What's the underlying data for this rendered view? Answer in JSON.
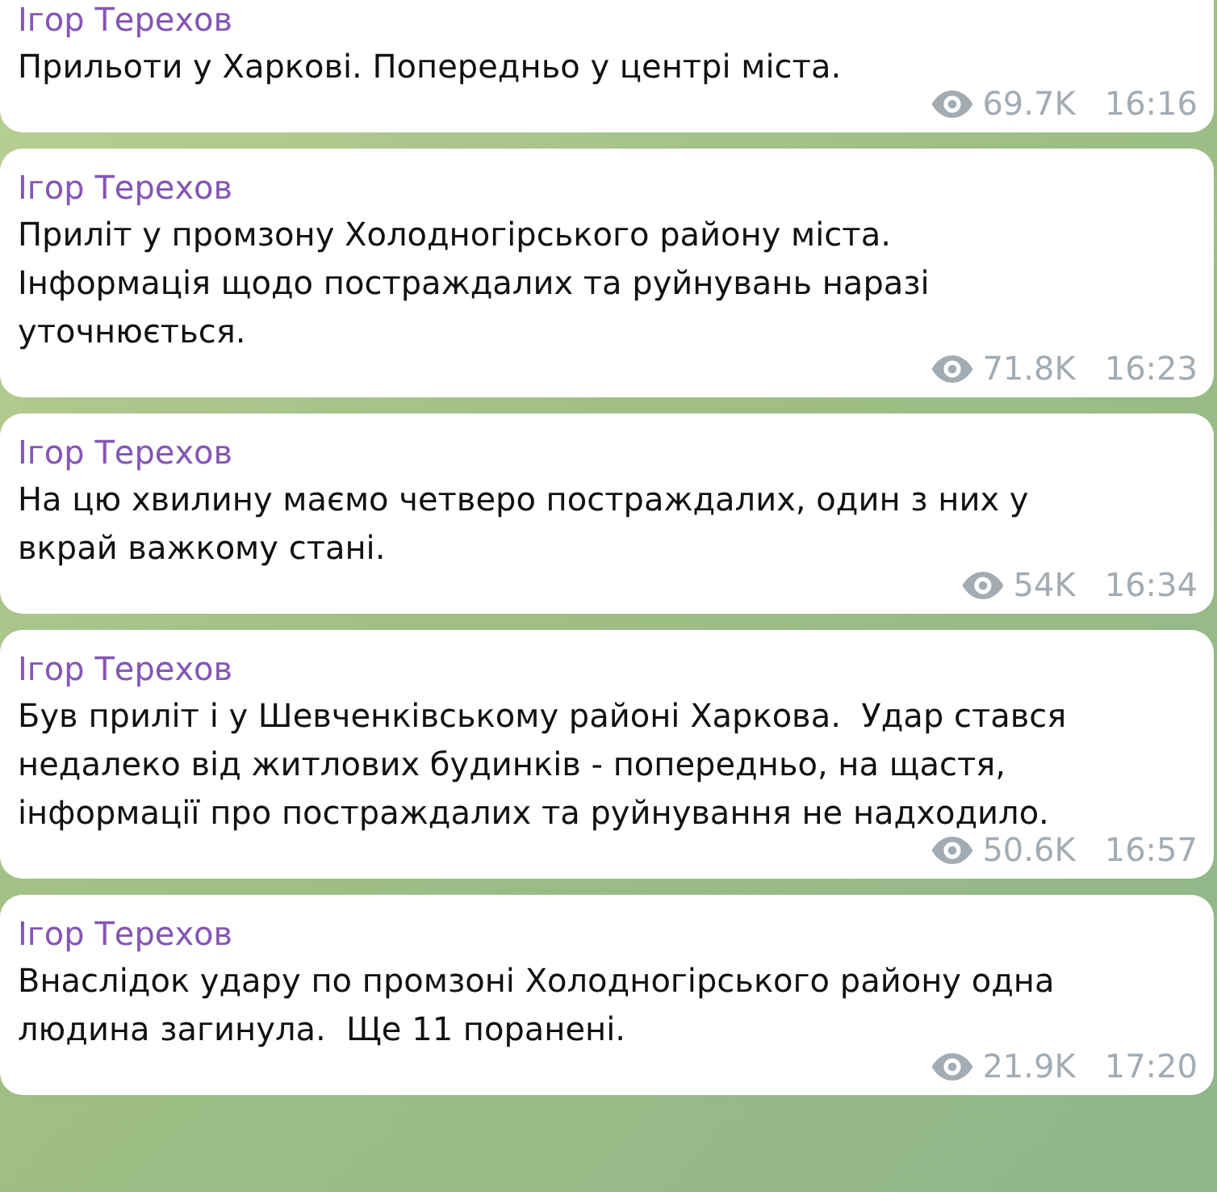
{
  "messages": [
    {
      "author": "Ігор Терехов",
      "text": "Прильоти у Харкові. Попередньо у центрі міста.",
      "views": "69.7K",
      "time": "16:16"
    },
    {
      "author": "Ігор Терехов",
      "text": "Приліт у промзону Холодногірського району міста.\nІнформація щодо постраждалих та руйнувань наразі\nуточнюється.",
      "views": "71.8K",
      "time": "16:23"
    },
    {
      "author": "Ігор Терехов",
      "text": "На цю хвилину маємо четверо постраждалих, один з них у\nвкрай важкому стані.",
      "views": "54K",
      "time": "16:34"
    },
    {
      "author": "Ігор Терехов",
      "text": "Був приліт і у Шевченківському районі Харкова.  Удар стався\nнедалеко від житлових будинків - попередньо, на щастя,\nінформації про постраждалих та руйнування не надходило.",
      "views": "50.6K",
      "time": "16:57"
    },
    {
      "author": "Ігор Терехов",
      "text": "Внаслідок удару по промзоні Холодногірського району одна\nлюдина загинула.  Ще 11 поранені.",
      "views": "21.9K",
      "time": "17:20"
    }
  ]
}
